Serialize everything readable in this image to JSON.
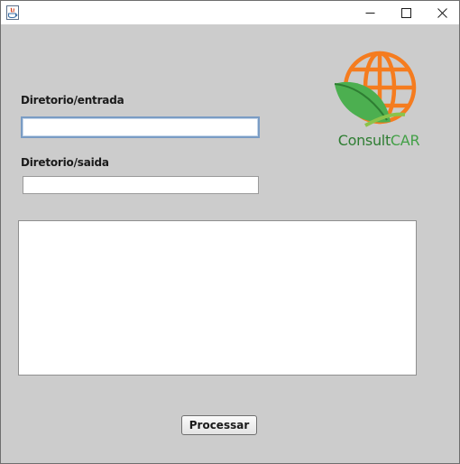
{
  "window": {
    "title": "",
    "controls": {
      "minimize_icon": "minimize-icon",
      "maximize_icon": "maximize-icon",
      "close_icon": "close-icon"
    }
  },
  "form": {
    "entrada_label": "Diretorio/entrada",
    "entrada_value": "",
    "saida_label": "Diretorio/saida",
    "saida_value": "",
    "output_text": "",
    "process_button": "Processar"
  },
  "logo": {
    "text_part1": "Consult",
    "text_part2": "CAR",
    "globe_color": "#f57c1f",
    "leaf_color": "#4caf50",
    "text_color": "#2e7d32"
  }
}
